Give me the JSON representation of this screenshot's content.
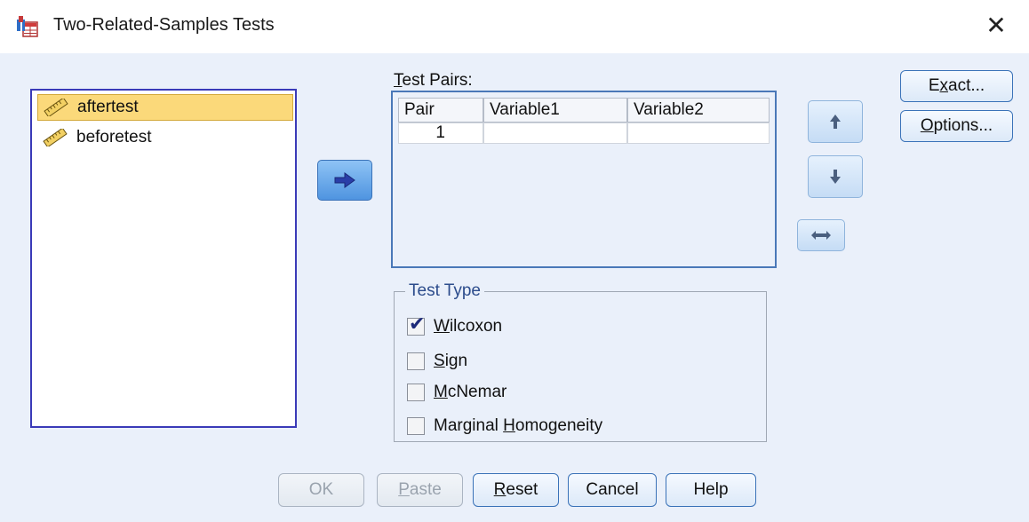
{
  "window": {
    "title": "Two-Related-Samples Tests"
  },
  "variables": [
    {
      "name": "aftertest",
      "selected": true
    },
    {
      "name": "beforetest",
      "selected": false
    }
  ],
  "test_pairs": {
    "label_accel": "T",
    "label_rest": "est Pairs:",
    "columns": [
      "Pair",
      "Variable1",
      "Variable2"
    ],
    "rows": [
      {
        "pair": "1",
        "var1": "",
        "var2": ""
      }
    ]
  },
  "test_type": {
    "legend": "Test Type",
    "options": [
      {
        "accel": "W",
        "rest": "ilcoxon",
        "pre": "",
        "checked": true
      },
      {
        "accel": "S",
        "rest": "ign",
        "pre": "",
        "checked": false
      },
      {
        "accel": "M",
        "rest": "cNemar",
        "pre": "",
        "checked": false
      },
      {
        "accel": "H",
        "rest": "omogeneity",
        "pre": "Marginal ",
        "checked": false
      }
    ]
  },
  "side_buttons": {
    "exact": {
      "pre": "E",
      "accel": "x",
      "rest": "act..."
    },
    "options": {
      "pre": "",
      "accel": "O",
      "rest": "ptions..."
    }
  },
  "footer": {
    "ok": "OK",
    "paste": {
      "accel": "P",
      "rest": "aste"
    },
    "reset": {
      "accel": "R",
      "rest": "eset"
    },
    "cancel": "Cancel",
    "help": "Help"
  },
  "colors": {
    "accent": "#4f94e0",
    "selection": "#fbd97a",
    "list_border": "#3a3ab8"
  },
  "icons": [
    "app-icon",
    "ruler-icon",
    "arrow-right-icon",
    "arrow-up-icon",
    "arrow-down-icon",
    "swap-icon",
    "close-icon",
    "checkmark-icon"
  ]
}
